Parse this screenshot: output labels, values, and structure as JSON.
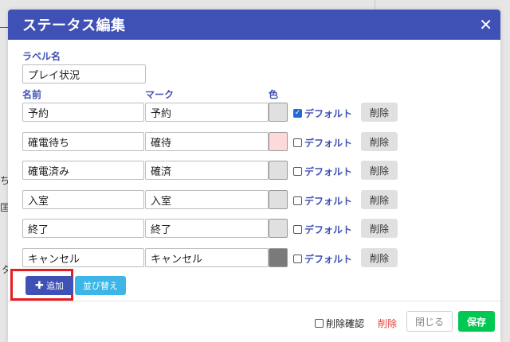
{
  "background": {
    "fragments": [
      "ちゃ",
      "匡,",
      "タ"
    ]
  },
  "modal": {
    "title": "ステータス編集",
    "close_glyph": "✕",
    "label_name_heading": "ラベル名",
    "label_name_value": "プレイ状況",
    "col_name": "名前",
    "col_mark": "マーク",
    "col_color": "色",
    "rows": [
      {
        "name": "予約",
        "mark": "予約",
        "color": "#e0e0e0",
        "default_label": "デフォルト",
        "is_default": true,
        "delete_label": "削除"
      },
      {
        "name": "確電待ち",
        "mark": "確待",
        "color": "#fdd9d9",
        "default_label": "デフォルト",
        "is_default": false,
        "delete_label": "削除"
      },
      {
        "name": "確電済み",
        "mark": "確済",
        "color": "#e0e0e0",
        "default_label": "デフォルト",
        "is_default": false,
        "delete_label": "削除"
      },
      {
        "name": "入室",
        "mark": "入室",
        "color": "#e0e0e0",
        "default_label": "デフォルト",
        "is_default": false,
        "delete_label": "削除"
      },
      {
        "name": "終了",
        "mark": "終了",
        "color": "#e0e0e0",
        "default_label": "デフォルト",
        "is_default": false,
        "delete_label": "削除"
      },
      {
        "name": "キャンセル",
        "mark": "キャンセル",
        "color": "#7a7a7a",
        "default_label": "デフォルト",
        "is_default": false,
        "delete_label": "削除"
      }
    ],
    "add_button": {
      "icon": "plus-icon",
      "label": "追加"
    },
    "sort_button": {
      "label": "並び替え"
    },
    "footer": {
      "confirm_delete_label": "削除確認",
      "confirm_delete_checked": false,
      "delete_label": "削除",
      "close_label": "閉じる",
      "save_label": "保存"
    }
  },
  "colors": {
    "header": "#3f51b5",
    "accent_label": "#3f51b5",
    "save": "#00c853",
    "sort": "#3db5e6",
    "danger": "#e53935",
    "highlight": "#e51c23"
  }
}
